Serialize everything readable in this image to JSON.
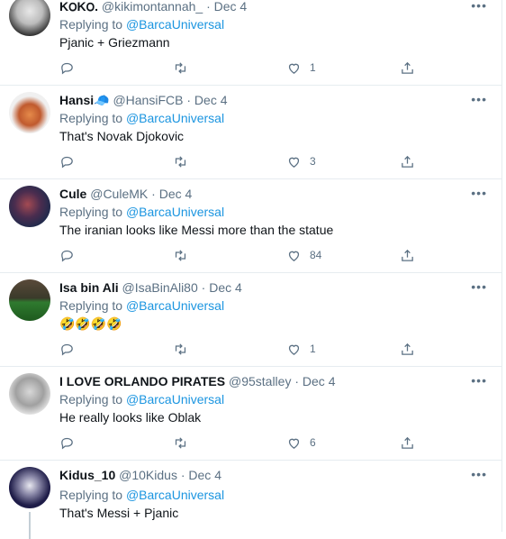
{
  "tweets": [
    {
      "name": "K౦K౦.",
      "handle": "@kikimontannah_",
      "dot": "·",
      "date": "Dec 4",
      "replying_prefix": "Replying to",
      "replying_to": "@BarcaUniversal",
      "text": "Pjanic + Griezmann",
      "likes": "1"
    },
    {
      "name": "Hansi🧢",
      "handle": "@HansiFCB",
      "dot": "·",
      "date": "Dec 4",
      "replying_prefix": "Replying to",
      "replying_to": "@BarcaUniversal",
      "text": "That's Novak Djokovic",
      "likes": "3"
    },
    {
      "name": "Cule",
      "handle": "@CuleMK",
      "dot": "·",
      "date": "Dec 4",
      "replying_prefix": "Replying to",
      "replying_to": "@BarcaUniversal",
      "text": "The iranian looks like Messi more than the statue",
      "likes": "84"
    },
    {
      "name": "Isa bin Ali",
      "handle": "@IsaBinAli80",
      "dot": "·",
      "date": "Dec 4",
      "replying_prefix": "Replying to",
      "replying_to": "@BarcaUniversal",
      "text": "🤣🤣🤣🤣",
      "likes": "1"
    },
    {
      "name": "I LOVE ORLANDO PIRATES",
      "handle": "@95stalley",
      "dot": "·",
      "date": "Dec 4",
      "replying_prefix": "Replying to",
      "replying_to": "@BarcaUniversal",
      "text": "He really looks like Oblak",
      "likes": "6"
    },
    {
      "name": "Kidus_10",
      "handle": "@10Kidus",
      "dot": "·",
      "date": "Dec 4",
      "replying_prefix": "Replying to",
      "replying_to": "@BarcaUniversal",
      "text": "That's Messi + Pjanic",
      "likes": ""
    }
  ],
  "more_label": "•••",
  "icons": {
    "reply": "reply-icon",
    "retweet": "retweet-icon",
    "like": "heart-icon",
    "share": "share-icon",
    "more": "more-icon"
  },
  "colors": {
    "link": "#1b95e0",
    "muted": "#5b7083",
    "divider": "#e6ecf0"
  }
}
